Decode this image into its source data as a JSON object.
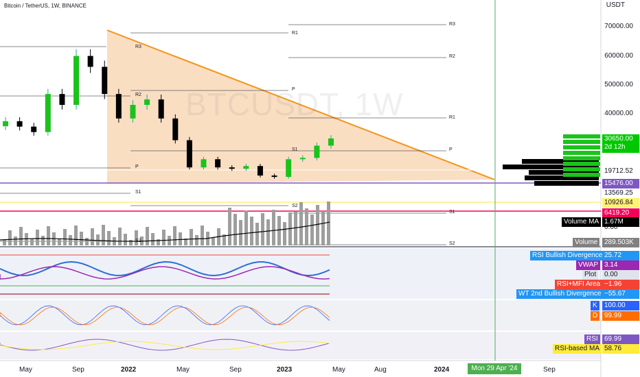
{
  "header": {
    "symbol_title": "Bitcoin / TetherUS, 1W, BINANCE",
    "currency": "USDT",
    "watermark": "BTCUSDT, 1W"
  },
  "price_axis": {
    "ticks": [
      "70000.00",
      "60000.00",
      "50000.00",
      "40000.00"
    ],
    "price_tags": [
      {
        "label": "30650.00",
        "sub": "2d 12h",
        "bg": "#00c800",
        "fg": "#ffffff"
      },
      {
        "label": "19712.52",
        "bg": "#ffffff",
        "fg": "#131722"
      },
      {
        "label": "15476.00",
        "bg": "#7e57c2",
        "fg": "#ffffff"
      },
      {
        "label": "13569.25",
        "bg": "#ffffff",
        "fg": "#131722"
      },
      {
        "label": "10926.84",
        "bg": "#fff176",
        "fg": "#131722"
      },
      {
        "label": "6419.20",
        "bg": "#f50057",
        "fg": "#ffffff"
      },
      {
        "label": "0.00",
        "bg": "#ffffff",
        "fg": "#131722"
      }
    ]
  },
  "pivots": {
    "labels": [
      "R3",
      "R1",
      "R3",
      "R2",
      "P",
      "R2",
      "R1",
      "S1",
      "P",
      "P",
      "S1",
      "S1",
      "S2",
      "S2",
      "S2"
    ]
  },
  "volume": {
    "ma_label": "Volume MA",
    "ma_value": "1.67M",
    "label": "Volume",
    "value": "289.503K"
  },
  "indicator_tags": {
    "rsi_bull_div": {
      "label": "RSI Bullish Divergence",
      "value": "25.72"
    },
    "vwap": {
      "label": "VWAP",
      "value": "3.14"
    },
    "plot": {
      "label": "Plot",
      "value": "0.00"
    },
    "rsi_mfi": {
      "label": "RSI+MFI Area",
      "value": "−1.96"
    },
    "wt_div": {
      "label": "WT 2nd Bullish Divergence",
      "value": "−55.67"
    },
    "k": {
      "label": "K",
      "value": "100.00"
    },
    "d": {
      "label": "D",
      "value": "99.99"
    },
    "rsi": {
      "label": "RSI",
      "value": "69.99"
    },
    "rsi_ma": {
      "label": "RSI-based MA",
      "value": "58.76"
    }
  },
  "time_axis": {
    "labels": [
      {
        "text": "May",
        "bold": false
      },
      {
        "text": "Sep",
        "bold": false
      },
      {
        "text": "2022",
        "bold": true
      },
      {
        "text": "May",
        "bold": false
      },
      {
        "text": "Sep",
        "bold": false
      },
      {
        "text": "2023",
        "bold": true
      },
      {
        "text": "May",
        "bold": false
      },
      {
        "text": "Aug",
        "bold": false
      },
      {
        "text": "2024",
        "bold": true
      },
      {
        "text": "Sep",
        "bold": false
      }
    ],
    "cursor_date": "Mon 29 Apr '24"
  },
  "chart_data": {
    "type": "candlestick",
    "title": "Bitcoin / TetherUS, 1W, BINANCE",
    "ylabel": "USDT",
    "ylim": [
      0,
      75000
    ],
    "x": [
      "2021-05",
      "2021-06",
      "2021-07",
      "2021-08",
      "2021-09",
      "2021-10",
      "2021-11",
      "2021-12",
      "2022-01",
      "2022-02",
      "2022-03",
      "2022-04",
      "2022-05",
      "2022-06",
      "2022-07",
      "2022-08",
      "2022-09",
      "2022-10",
      "2022-11",
      "2022-12",
      "2023-01",
      "2023-02",
      "2023-03",
      "2023-04"
    ],
    "close": [
      37000,
      35000,
      33000,
      47000,
      43000,
      61000,
      57000,
      47000,
      38000,
      43000,
      45000,
      38000,
      30000,
      20000,
      23000,
      20000,
      19500,
      20500,
      17000,
      16500,
      23000,
      23500,
      28000,
      30650
    ],
    "volume_ma": 1670000,
    "last_price": 30650,
    "colors": {
      "up": "#26a69a",
      "down": "#000000",
      "trend": "#f7931a"
    }
  }
}
